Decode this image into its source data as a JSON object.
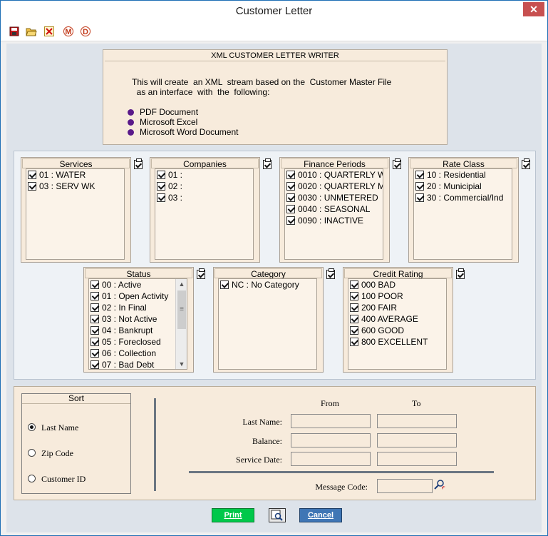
{
  "window": {
    "title": "Customer Letter",
    "close_glyph": "✕"
  },
  "toolbar": {
    "icons": [
      "save-icon",
      "open-folder-icon",
      "delete-icon",
      "m-circle-icon",
      "d-circle-icon"
    ],
    "m_label": "M",
    "d_label": "D"
  },
  "header": {
    "title": "XML CUSTOMER LETTER WRITER",
    "line1": "This will create  an XML  stream based on the  Customer Master File",
    "line2": "  as an interface  with  the  following:",
    "bullets": [
      "PDF  Document",
      "Microsoft  Excel",
      "Microsoft  Word  Document"
    ],
    "bullet_color": "#5a1a8a"
  },
  "panels": {
    "services": {
      "title": "Services",
      "items": [
        "01 : WATER",
        "03 : SERV WK"
      ]
    },
    "companies": {
      "title": "Companies",
      "items": [
        "01 :",
        "02 :",
        "03 :"
      ]
    },
    "finance": {
      "title": "Finance Periods",
      "items": [
        "0010 : QUARTERLY W",
        "0020 : QUARTERLY M",
        "0030 : UNMETERED",
        "0040 : SEASONAL",
        "0090 : INACTIVE"
      ]
    },
    "rate": {
      "title": "Rate Class",
      "items": [
        "10 : Residential",
        "20 : Municipial",
        "30 : Commercial/Ind"
      ]
    },
    "status": {
      "title": "Status",
      "items": [
        "00 : Active",
        "01 : Open Activity",
        "02 : In Final",
        "03 : Not Active",
        "04 : Bankrupt",
        "05 : Foreclosed",
        "06 : Collection",
        "07 : Bad Debt"
      ]
    },
    "category": {
      "title": "Category",
      "items": [
        "NC : No Category"
      ]
    },
    "credit": {
      "title": "Credit Rating",
      "items": [
        "000 BAD",
        "100 POOR",
        "200 FAIR",
        "400 AVERAGE",
        "600 GOOD",
        "800 EXCELLENT"
      ]
    }
  },
  "sort": {
    "title": "Sort",
    "options": [
      "Last Name",
      "Zip Code",
      "Customer ID"
    ],
    "selected": "Last Name"
  },
  "range": {
    "from_label": "From",
    "to_label": "To",
    "rows": [
      "Last Name:",
      "Balance:",
      "Service Date:"
    ],
    "message_code_label": "Message Code:"
  },
  "buttons": {
    "print": "Print",
    "cancel": "Cancel"
  },
  "colors": {
    "accent_print": "#00c84a",
    "accent_cancel": "#3f76b5",
    "panel_bg": "#f7ebdc"
  }
}
